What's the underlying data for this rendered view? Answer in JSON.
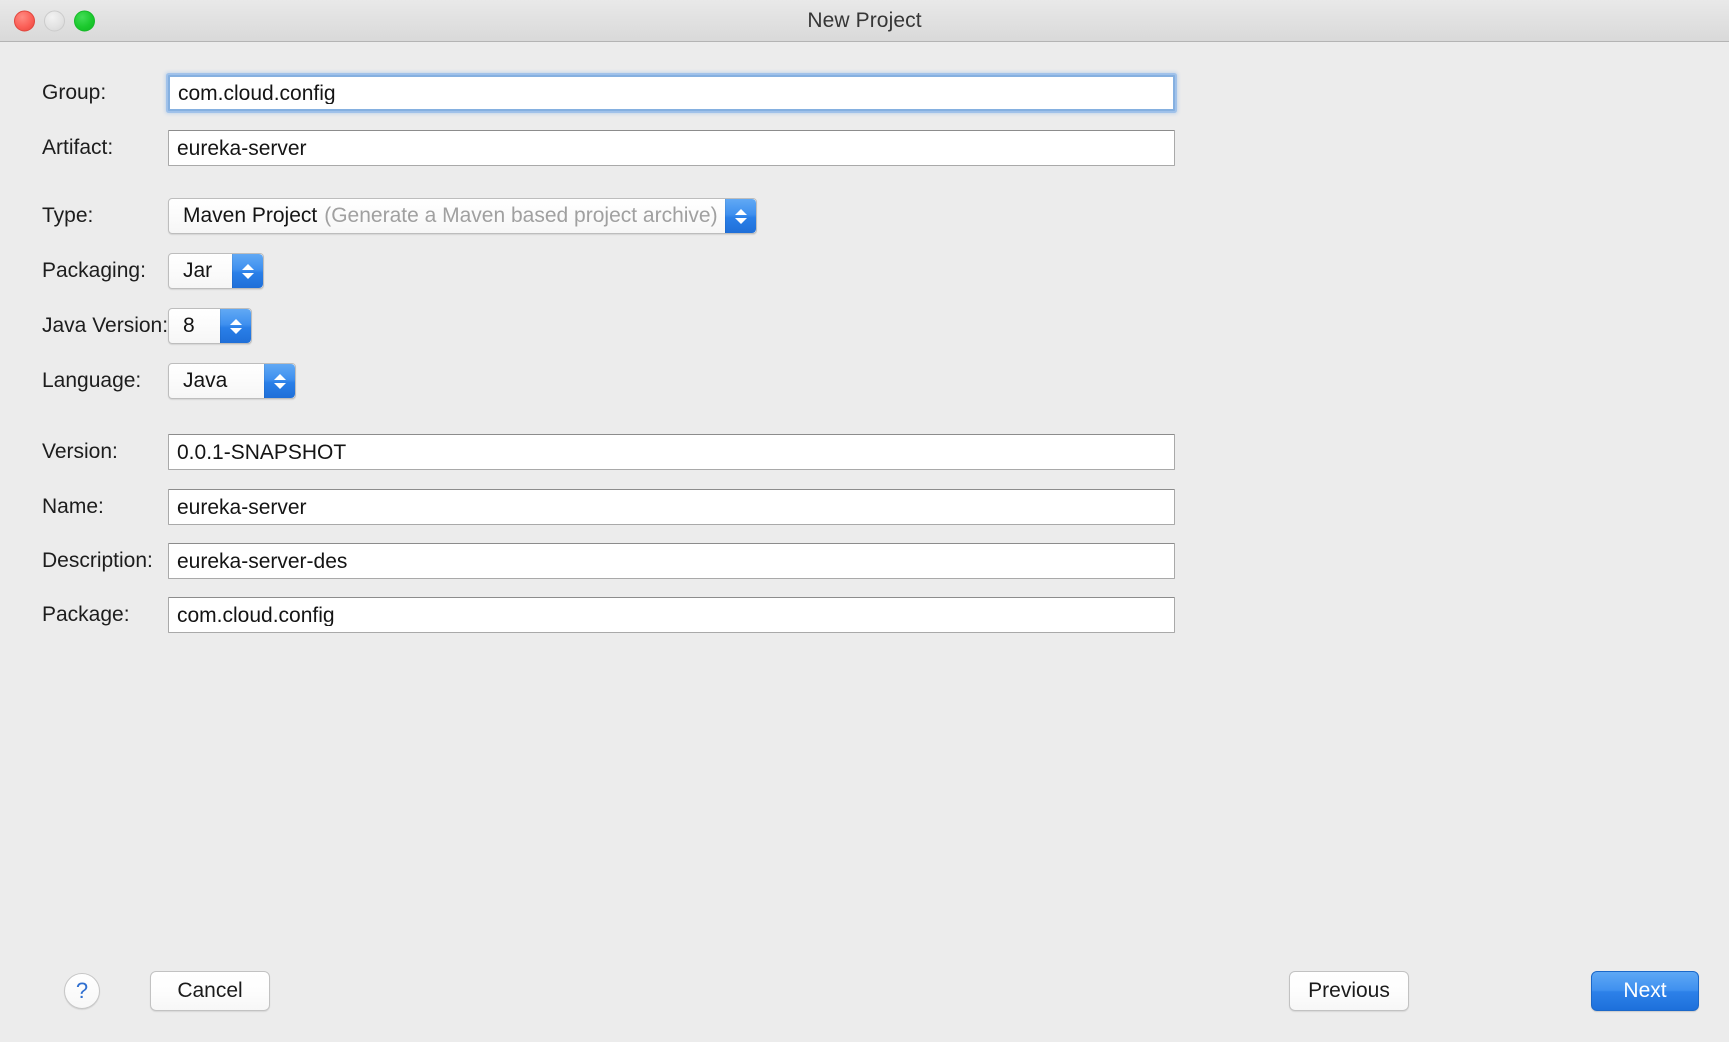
{
  "window": {
    "title": "New Project",
    "traffic_lights": [
      "close",
      "minimize",
      "zoom"
    ]
  },
  "form": {
    "rows": [
      {
        "label": "Group:",
        "value": "com.cloud.config",
        "control": "textfield",
        "focused": true
      },
      {
        "label": "Artifact:",
        "value": "eureka-server",
        "control": "textfield",
        "focused": false
      },
      {
        "label": "Type:",
        "value": "Maven Project",
        "hint": "(Generate a Maven based project archive)",
        "control": "popup"
      },
      {
        "label": "Packaging:",
        "value": "Jar",
        "control": "popup"
      },
      {
        "label": "Java Version:",
        "value": "8",
        "control": "popup"
      },
      {
        "label": "Language:",
        "value": "Java",
        "control": "popup"
      },
      {
        "label": "Version:",
        "value": "0.0.1-SNAPSHOT",
        "control": "textfield",
        "focused": false
      },
      {
        "label": "Name:",
        "value": "eureka-server",
        "control": "textfield",
        "focused": false
      },
      {
        "label": "Description:",
        "value": "eureka-server-des",
        "control": "textfield",
        "focused": false
      },
      {
        "label": "Package:",
        "value": "com.cloud.config",
        "control": "textfield",
        "focused": false
      }
    ]
  },
  "footer": {
    "help_label": "?",
    "cancel_label": "Cancel",
    "previous_label": "Previous",
    "next_label": "Next"
  },
  "colors": {
    "accent_blue": "#2d81e9",
    "stepper_blue": "#3f90ef",
    "focus_ring": "#85b0e0",
    "window_bg": "#ececec",
    "help_glyph_blue": "#2f6fd0"
  }
}
